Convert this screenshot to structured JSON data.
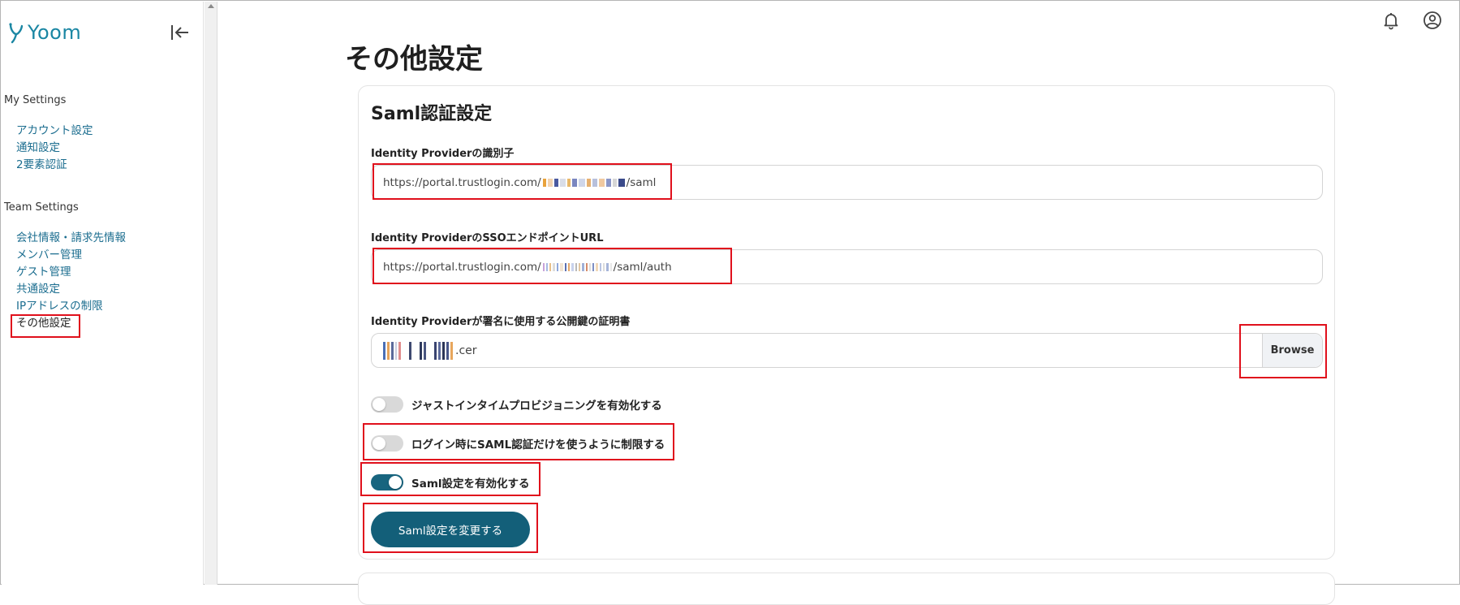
{
  "brand": {
    "name": "Yoom",
    "color": "#1a86a3"
  },
  "sidebar": {
    "collapse_icon": "collapse-left-icon",
    "my_settings": {
      "title": "My Settings",
      "items": [
        {
          "label": "アカウント設定"
        },
        {
          "label": "通知設定"
        },
        {
          "label": "2要素認証"
        }
      ]
    },
    "team_settings": {
      "title": "Team Settings",
      "items": [
        {
          "label": "会社情報・請求先情報"
        },
        {
          "label": "メンバー管理"
        },
        {
          "label": "ゲスト管理"
        },
        {
          "label": "共通設定"
        },
        {
          "label": "IPアドレスの制限"
        },
        {
          "label": "その他設定",
          "active": true
        }
      ]
    }
  },
  "header": {
    "notification_icon": "bell-icon",
    "profile_icon": "user-circle-icon"
  },
  "page": {
    "title": "その他設定"
  },
  "saml": {
    "title": "Saml認証設定",
    "idp_identifier": {
      "label": "Identity Providerの識別子",
      "value_prefix": "https://portal.trustlogin.com/",
      "value_suffix": "/saml"
    },
    "sso_endpoint": {
      "label": "Identity ProviderのSSOエンドポイントURL",
      "value_prefix": "https://portal.trustlogin.com/",
      "value_suffix": "/saml/auth"
    },
    "certificate": {
      "label": "Identity Providerが署名に使用する公開鍵の証明書",
      "file_suffix": ".cer",
      "browse_label": "Browse"
    },
    "toggles": [
      {
        "label": "ジャストインタイムプロビジョニングを有効化する",
        "on": false
      },
      {
        "label": "ログイン時にSAML認証だけを使うように制限する",
        "on": false
      },
      {
        "label": "Saml設定を有効化する",
        "on": true
      }
    ],
    "submit_label": "Saml設定を変更する"
  },
  "colors": {
    "accent": "#135f79",
    "highlight": "#e0101c",
    "link": "#1b6d8f"
  }
}
